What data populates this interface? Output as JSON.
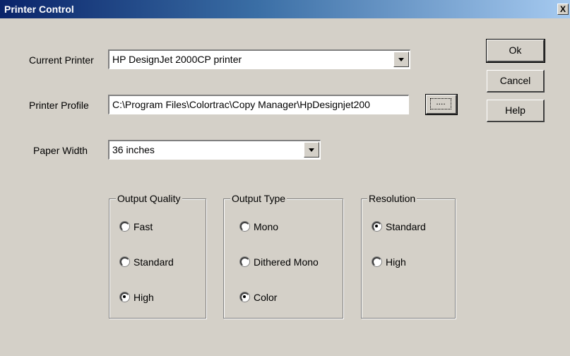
{
  "window": {
    "title": "Printer Control",
    "close_label": "X"
  },
  "form": {
    "current_printer": {
      "label": "Current Printer",
      "value": "HP DesignJet 2000CP printer"
    },
    "printer_profile": {
      "label": "Printer Profile",
      "value": "C:\\Program Files\\Colortrac\\Copy Manager\\HpDesignjet200",
      "browse_label": "...."
    },
    "paper_width": {
      "label": "Paper Width",
      "value": "36 inches"
    }
  },
  "buttons": {
    "ok": "Ok",
    "cancel": "Cancel",
    "help": "Help"
  },
  "groups": {
    "output_quality": {
      "title": "Output Quality",
      "options": [
        {
          "label": "Fast",
          "selected": false
        },
        {
          "label": "Standard",
          "selected": false
        },
        {
          "label": "High",
          "selected": true
        }
      ]
    },
    "output_type": {
      "title": "Output Type",
      "options": [
        {
          "label": "Mono",
          "selected": false
        },
        {
          "label": "Dithered Mono",
          "selected": false
        },
        {
          "label": "Color",
          "selected": true
        }
      ]
    },
    "resolution": {
      "title": "Resolution",
      "options": [
        {
          "label": "Standard",
          "selected": true
        },
        {
          "label": "High",
          "selected": false
        }
      ]
    }
  }
}
